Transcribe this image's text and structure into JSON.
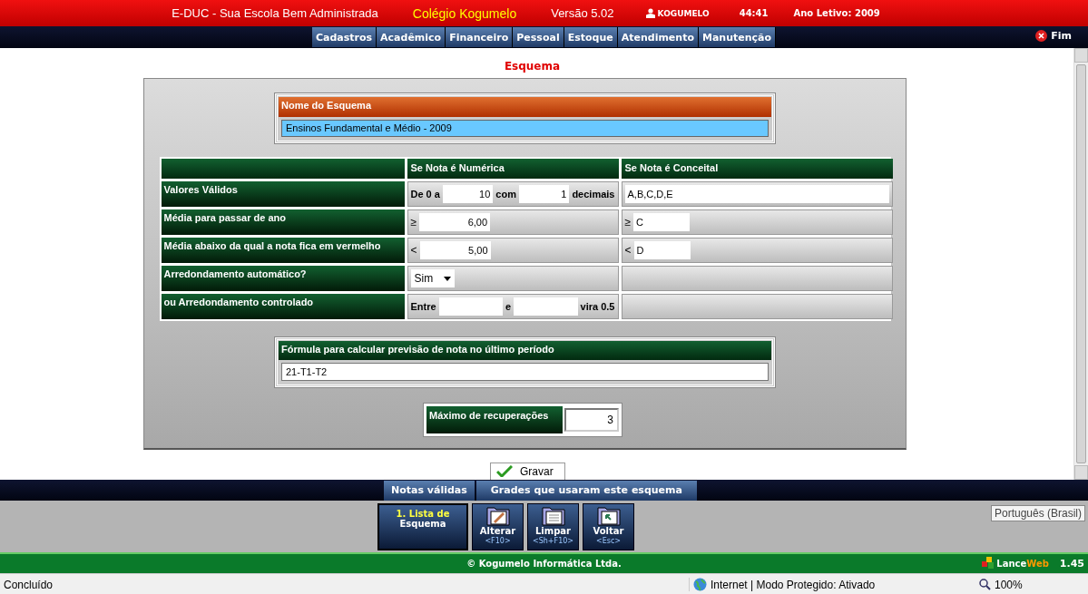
{
  "header": {
    "app": "E-DUC - Sua Escola Bem Administrada",
    "school": "Colégio Kogumelo",
    "version": "Versão 5.02",
    "user": "KOGUMELO",
    "timer": "44:41",
    "year": "Ano Letivo: 2009"
  },
  "menu": [
    {
      "label": "Cadastros"
    },
    {
      "label": "Acadêmico"
    },
    {
      "label": "Financeiro"
    },
    {
      "label": "Pessoal"
    },
    {
      "label": "Estoque"
    },
    {
      "label": "Atendimento"
    },
    {
      "label": "Manutenção"
    }
  ],
  "exit": "Fim",
  "page_title": "Esquema",
  "name_box": {
    "label": "Nome do Esquema",
    "value": "Ensinos Fundamental e Médio - 2009"
  },
  "grid": {
    "columns": [
      "Se Nota é Numérica",
      "Se Nota é Conceital"
    ],
    "rows": [
      {
        "label": "Valores Válidos",
        "numeric": [
          {
            "kind": "text",
            "text": "De 0 a"
          },
          {
            "kind": "input",
            "value": "10"
          },
          {
            "kind": "text",
            "text": "com"
          },
          {
            "kind": "input",
            "value": "1"
          },
          {
            "kind": "text",
            "text": "decimais"
          }
        ],
        "concept": [
          {
            "kind": "wide",
            "value": "A,B,C,D,E"
          }
        ]
      },
      {
        "label": "Média para passar de ano",
        "numeric": [
          {
            "kind": "sign",
            "text": "≥"
          },
          {
            "kind": "input",
            "value": "6,00"
          }
        ],
        "concept": [
          {
            "kind": "sign",
            "text": "≥"
          },
          {
            "kind": "short",
            "value": "C"
          }
        ]
      },
      {
        "label": "Média abaixo da qual a nota fica em vermelho",
        "numeric": [
          {
            "kind": "sign",
            "text": "<"
          },
          {
            "kind": "input",
            "value": "5,00"
          }
        ],
        "concept": [
          {
            "kind": "sign",
            "text": "<"
          },
          {
            "kind": "short",
            "value": "D"
          }
        ]
      },
      {
        "label": "Arredondamento automático?",
        "numeric": [
          {
            "kind": "select",
            "value": "Sim"
          }
        ],
        "concept": []
      },
      {
        "label": "ou Arredondamento controlado",
        "numeric": [
          {
            "kind": "text",
            "text": "Entre"
          },
          {
            "kind": "input"
          },
          {
            "kind": "text",
            "text": "e"
          },
          {
            "kind": "input"
          },
          {
            "kind": "text",
            "text": "vira 0.5"
          }
        ],
        "concept": []
      }
    ]
  },
  "formula": {
    "label": "Fórmula para calcular previsão de nota no último período",
    "value": "21-T1-T2"
  },
  "max_recovery": {
    "label": "Máximo de recuperações",
    "value": "3"
  },
  "save_button": "Gravar",
  "bottom_tabs": [
    "Notas válidas",
    "Grades que usaram este esquema"
  ],
  "actions": [
    {
      "kind": "list",
      "line1": "1. Lista de",
      "line2": "Esquema"
    },
    {
      "kind": "edit",
      "label": "Alterar",
      "key": "<F10>"
    },
    {
      "kind": "clear",
      "label": "Limpar",
      "key": "<Sh+F10>"
    },
    {
      "kind": "back",
      "label": "Voltar",
      "key": "<Esc>"
    }
  ],
  "tooltip": "Português (Brasil)",
  "footer": {
    "copyright": "© Kogumelo Informática Ltda.",
    "brand_a": "Lance",
    "brand_b": "Web",
    "version": "1.45"
  },
  "status_bar": {
    "status": "Concluído",
    "zone": "Internet | Modo Protegido: Ativado",
    "zoom": "100%"
  }
}
